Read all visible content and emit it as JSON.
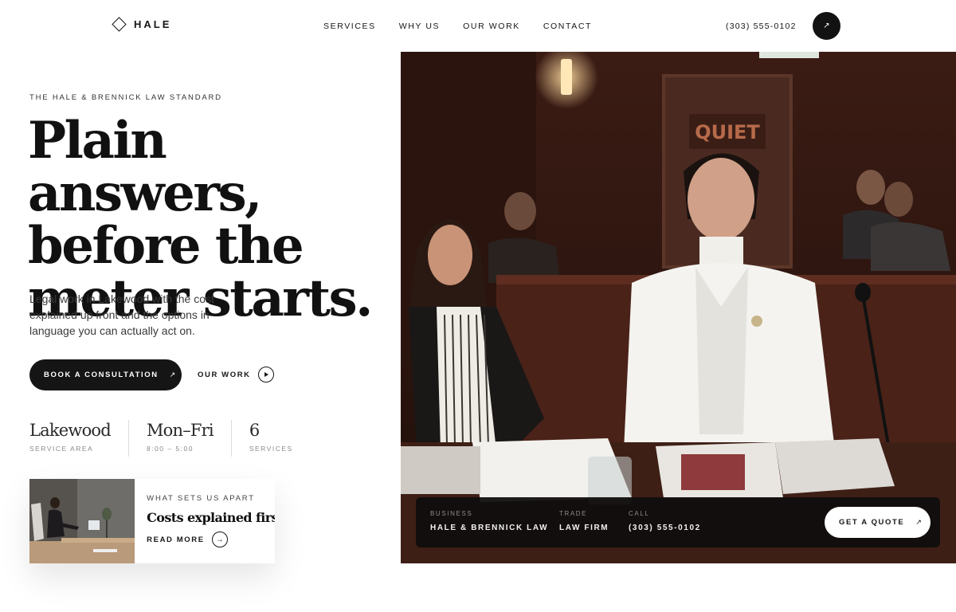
{
  "brand": {
    "name": "HALE"
  },
  "nav": {
    "items": [
      "SERVICES",
      "WHY US",
      "OUR WORK",
      "CONTACT"
    ]
  },
  "header": {
    "phone": "(303) 555-0102",
    "action_icon": "arrow-up-right-icon"
  },
  "hero": {
    "eyebrow": "THE HALE & BRENNICK LAW STANDARD",
    "headline": [
      "Plain answers,",
      "before the",
      "meter starts."
    ],
    "lede": "Legal work in Lakewood with the cost explained up front and the options in language you can actually act on.",
    "cta_primary": "BOOK A CONSULTATION",
    "cta_secondary": "OUR WORK",
    "image_sign_text": "QUIET"
  },
  "stats": [
    {
      "value": "Lakewood",
      "label": "SERVICE AREA"
    },
    {
      "value": "Mon–Fri",
      "label": "8:00 – 5:00"
    },
    {
      "value": "6",
      "label": "SERVICES"
    }
  ],
  "feature_card": {
    "eyebrow": "WHAT SETS US APART",
    "title": "Costs explained first",
    "link": "READ MORE"
  },
  "info_bar": {
    "items": [
      {
        "label": "BUSINESS",
        "value": "HALE & BRENNICK LAW"
      },
      {
        "label": "TRADE",
        "value": "LAW FIRM"
      },
      {
        "label": "CALL",
        "value": "(303) 555-0102"
      }
    ],
    "cta": "GET A QUOTE"
  },
  "colors": {
    "ink": "#161616",
    "button_dark": "#151515",
    "background": "#ffffff",
    "courtroom_wood": "#4a2218"
  }
}
